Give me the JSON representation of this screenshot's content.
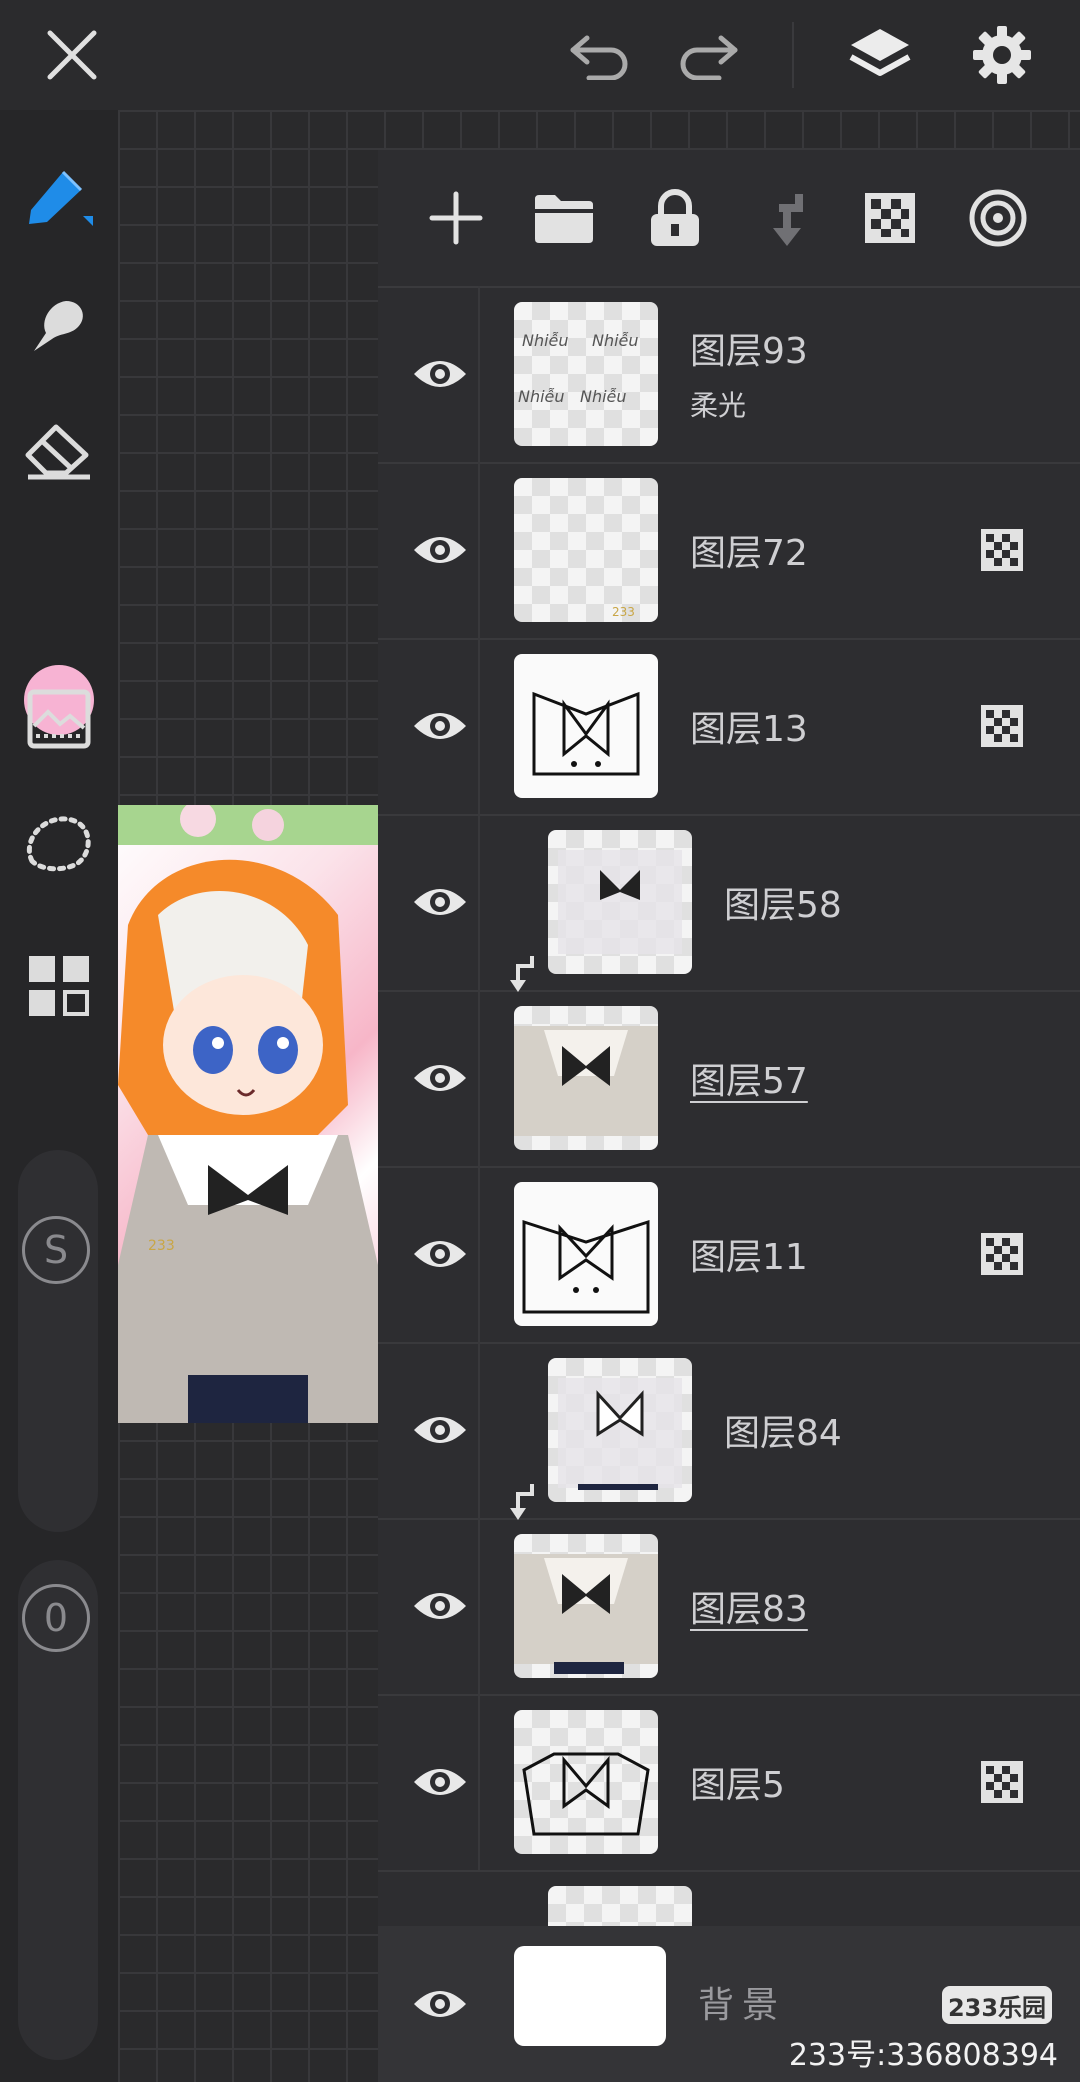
{
  "topbar": {
    "icons": [
      "close-icon",
      "undo-icon",
      "redo-icon",
      "layers-icon",
      "settings-icon"
    ]
  },
  "toolbar": {
    "icons": [
      "brush-icon",
      "smudge-icon",
      "eraser-icon",
      "adjustment-icon",
      "lasso-icon",
      "grid-icon"
    ],
    "color": "#f7b3d3",
    "size_slider_label": "S",
    "opacity_slider_label": "0"
  },
  "panel": {
    "tool_icons": [
      "add-layer-icon",
      "folder-icon",
      "lock-icon",
      "clip-down-icon",
      "alpha-lock-icon",
      "blend-target-icon"
    ],
    "layers": [
      {
        "name": "图层93",
        "mode": "柔光",
        "clipped": false,
        "alpha_lock": false,
        "underline": false
      },
      {
        "name": "图层72",
        "mode": "",
        "clipped": false,
        "alpha_lock": true,
        "underline": false
      },
      {
        "name": "图层13",
        "mode": "",
        "clipped": false,
        "alpha_lock": true,
        "underline": false
      },
      {
        "name": "图层58",
        "mode": "",
        "clipped": true,
        "alpha_lock": false,
        "underline": false
      },
      {
        "name": "图层57",
        "mode": "",
        "clipped": false,
        "alpha_lock": false,
        "underline": true
      },
      {
        "name": "图层11",
        "mode": "",
        "clipped": false,
        "alpha_lock": true,
        "underline": false
      },
      {
        "name": "图层84",
        "mode": "",
        "clipped": true,
        "alpha_lock": false,
        "underline": false
      },
      {
        "name": "图层83",
        "mode": "",
        "clipped": false,
        "alpha_lock": false,
        "underline": true
      },
      {
        "name": "图层5",
        "mode": "",
        "clipped": false,
        "alpha_lock": true,
        "underline": false
      }
    ],
    "background_label": "背景"
  },
  "watermark": {
    "logo": "233乐园",
    "text": "233号:336808394"
  }
}
